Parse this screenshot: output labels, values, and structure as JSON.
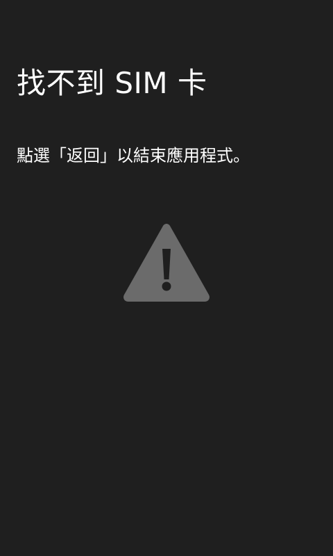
{
  "screen": {
    "title": "找不到 SIM 卡",
    "message": "點選「返回」以結束應用程式。",
    "icon": "warning-triangle-icon"
  },
  "colors": {
    "background": "#1f1f1f",
    "text": "#ffffff",
    "icon_fill": "#6b6b6b",
    "icon_mark": "#1f1f1f"
  }
}
